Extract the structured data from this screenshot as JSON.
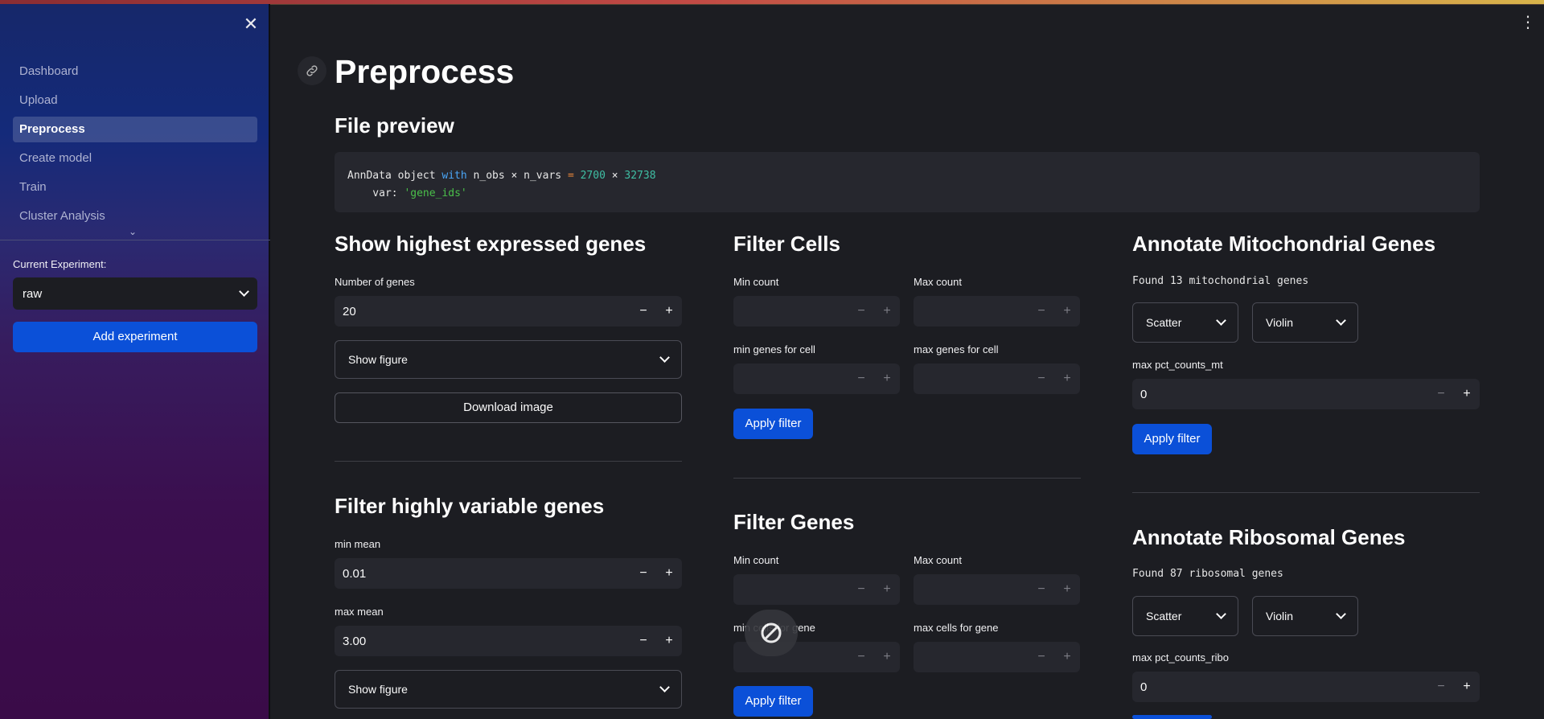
{
  "sidebar": {
    "nav": [
      "Dashboard",
      "Upload",
      "Preprocess",
      "Create model",
      "Train",
      "Cluster Analysis"
    ],
    "experiment_label": "Current Experiment:",
    "experiment_value": "raw",
    "add_experiment": "Add experiment"
  },
  "page": {
    "title": "Preprocess"
  },
  "preview": {
    "title": "File preview",
    "line1": {
      "a": "AnnData object ",
      "b": "with",
      "c": " n_obs × n_vars ",
      "d": "=",
      "e": " 2700",
      "f": " × ",
      "g": "32738"
    },
    "line2": {
      "a": "    var: ",
      "b": "'gene_ids'"
    }
  },
  "highest": {
    "title": "Show highest expressed genes",
    "n_label": "Number of genes",
    "n_value": "20",
    "figure": "Show figure",
    "download": "Download image"
  },
  "hvg": {
    "title": "Filter highly variable genes",
    "min_mean_label": "min mean",
    "min_mean_value": "0.01",
    "max_mean_label": "max mean",
    "max_mean_value": "3.00",
    "figure": "Show figure"
  },
  "filter_cells": {
    "title": "Filter Cells",
    "min_count": "Min count",
    "max_count": "Max count",
    "min_genes": "min genes for cell",
    "max_genes": "max genes for cell",
    "apply": "Apply filter"
  },
  "filter_genes": {
    "title": "Filter Genes",
    "min_count": "Min count",
    "max_count": "Max count",
    "min_cells": "min cells for gene",
    "max_cells": "max cells for gene",
    "apply": "Apply filter"
  },
  "mito": {
    "title": "Annotate Mitochondrial Genes",
    "found": "Found 13 mitochondrial genes",
    "scatter": "Scatter",
    "violin": "Violin",
    "max_label": "max pct_counts_mt",
    "max_value": "0",
    "apply": "Apply filter"
  },
  "ribo": {
    "title": "Annotate Ribosomal Genes",
    "found": "Found 87 ribosomal genes",
    "scatter": "Scatter",
    "violin": "Violin",
    "max_label": "max pct_counts_ribo",
    "max_value": "0"
  },
  "icons": {
    "close": "close-icon",
    "menu": "kebab-menu-icon",
    "link": "link-icon",
    "chevron": "chevron-down-icon",
    "blocked": "not-allowed-icon"
  },
  "colors": {
    "primary": "#0b50d8",
    "background": "#1c1d22",
    "input": "#26272e"
  }
}
